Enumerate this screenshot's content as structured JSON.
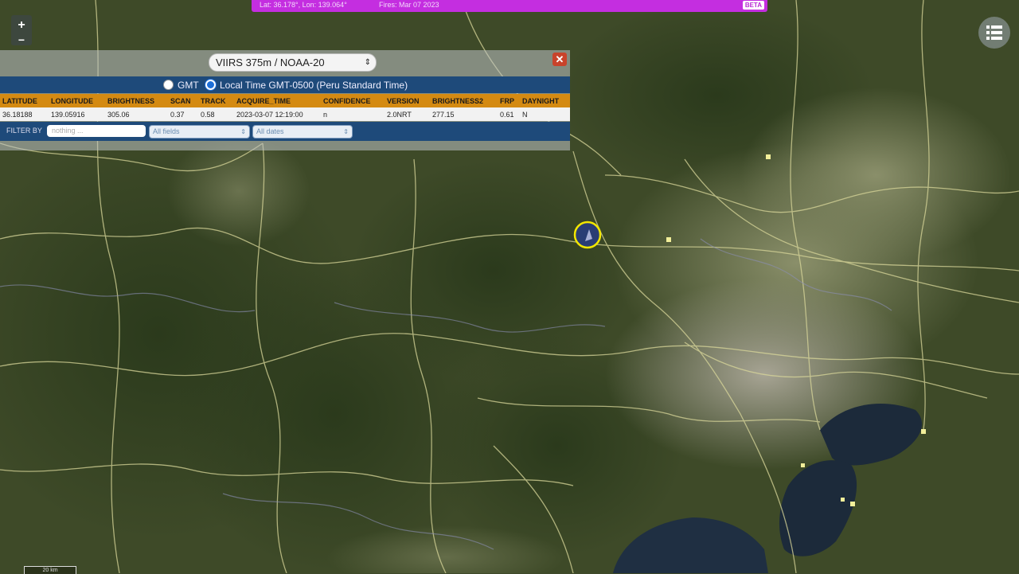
{
  "status_bar": {
    "coords": "Lat: 36.178°, Lon: 139.064°",
    "fires": "Fires: Mar 07 2023",
    "badge": "BETA",
    "color": "#c42ee0"
  },
  "zoom": {
    "in_label": "+",
    "out_label": "−"
  },
  "layers_button": {
    "icon": "layers-list-icon"
  },
  "popup": {
    "layer_select": "VIIRS 375m / NOAA-20",
    "close_label": "✕",
    "time": {
      "gmt_label": "GMT",
      "local_label": "Local Time GMT-0500 (Peru Standard Time)",
      "selected": "local"
    },
    "columns": [
      "LATITUDE",
      "LONGITUDE",
      "BRIGHTNESS",
      "SCAN",
      "TRACK",
      "ACQUIRE_TIME",
      "CONFIDENCE",
      "VERSION",
      "BRIGHTNESS2",
      "FRP",
      "DAYNIGHT"
    ],
    "row": [
      "36.18188",
      "139.05916",
      "305.06",
      "0.37",
      "0.58",
      "2023-03-07 12:19:00",
      "n",
      "2.0NRT",
      "277.15",
      "0.61",
      "N"
    ],
    "filter": {
      "label": "FILTER BY",
      "placeholder": "nothing ...",
      "fields_select": "All fields",
      "dates_select": "All dates"
    }
  },
  "scale_label": "20 km",
  "colors": {
    "panel_blue": "#1e4a7a",
    "header_orange": "#d48a12",
    "marker": "#f2e600"
  }
}
